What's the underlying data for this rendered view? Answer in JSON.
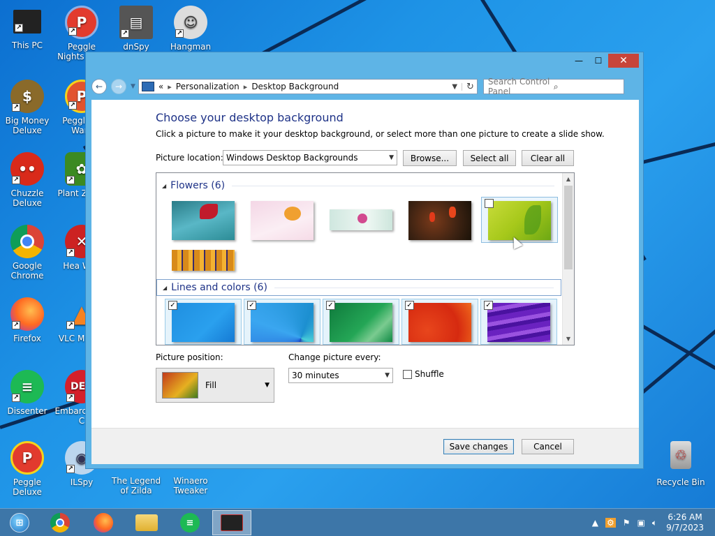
{
  "desktop": {
    "icons": [
      {
        "label": "This PC"
      },
      {
        "label": "Peggle Nights Delu"
      },
      {
        "label": "dnSpy"
      },
      {
        "label": "Hangman"
      },
      {
        "label": "Big Money Deluxe"
      },
      {
        "label": "Peggle of Warc"
      },
      {
        "label": "Chuzzle Deluxe"
      },
      {
        "label": "Plant Zomb"
      },
      {
        "label": "Google Chrome"
      },
      {
        "label": "Hea Wea"
      },
      {
        "label": "Firefox"
      },
      {
        "label": "VLC M Play"
      },
      {
        "label": "Dissenter"
      },
      {
        "label": "Embarc Dev-C"
      },
      {
        "label": "Peggle Deluxe"
      },
      {
        "label": "ILSpy"
      },
      {
        "label": "The Legend of Zilda"
      },
      {
        "label": "Winaero Tweaker"
      },
      {
        "label": "Recycle Bin"
      }
    ]
  },
  "window": {
    "controls": {
      "minimize": "—",
      "maximize": "☐",
      "close": "✕"
    },
    "nav": {
      "back": "←",
      "forward": "→",
      "recent": "▼"
    },
    "address": {
      "prefix": "«",
      "crumbs": [
        "Personalization",
        "Desktop Background"
      ],
      "separator": "▸",
      "dropdown": "▼",
      "refresh": "↻"
    },
    "search": {
      "placeholder": "Search Control Panel",
      "icon": "search-icon"
    }
  },
  "content": {
    "title": "Choose your desktop background",
    "description": "Click a picture to make it your desktop background, or select more than one picture to create a slide show.",
    "picture_location_label": "Picture location:",
    "picture_location_value": "Windows Desktop Backgrounds",
    "browse_label": "Browse...",
    "select_all_label": "Select all",
    "clear_all_label": "Clear all",
    "groups": [
      {
        "title": "Flowers (6)"
      },
      {
        "title": "Lines and colors (6)"
      }
    ],
    "picture_position_label": "Picture position:",
    "picture_position_value": "Fill",
    "change_every_label": "Change picture every:",
    "change_every_value": "30 minutes",
    "shuffle_label": "Shuffle",
    "save_label": "Save changes",
    "cancel_label": "Cancel"
  },
  "taskbar": {
    "clock_time": "6:26 AM",
    "clock_date": "9/7/2023"
  },
  "colors": {
    "title_blue": "#1e3287",
    "window_frame": "#5eb4e6",
    "close_red": "#c7453a"
  }
}
